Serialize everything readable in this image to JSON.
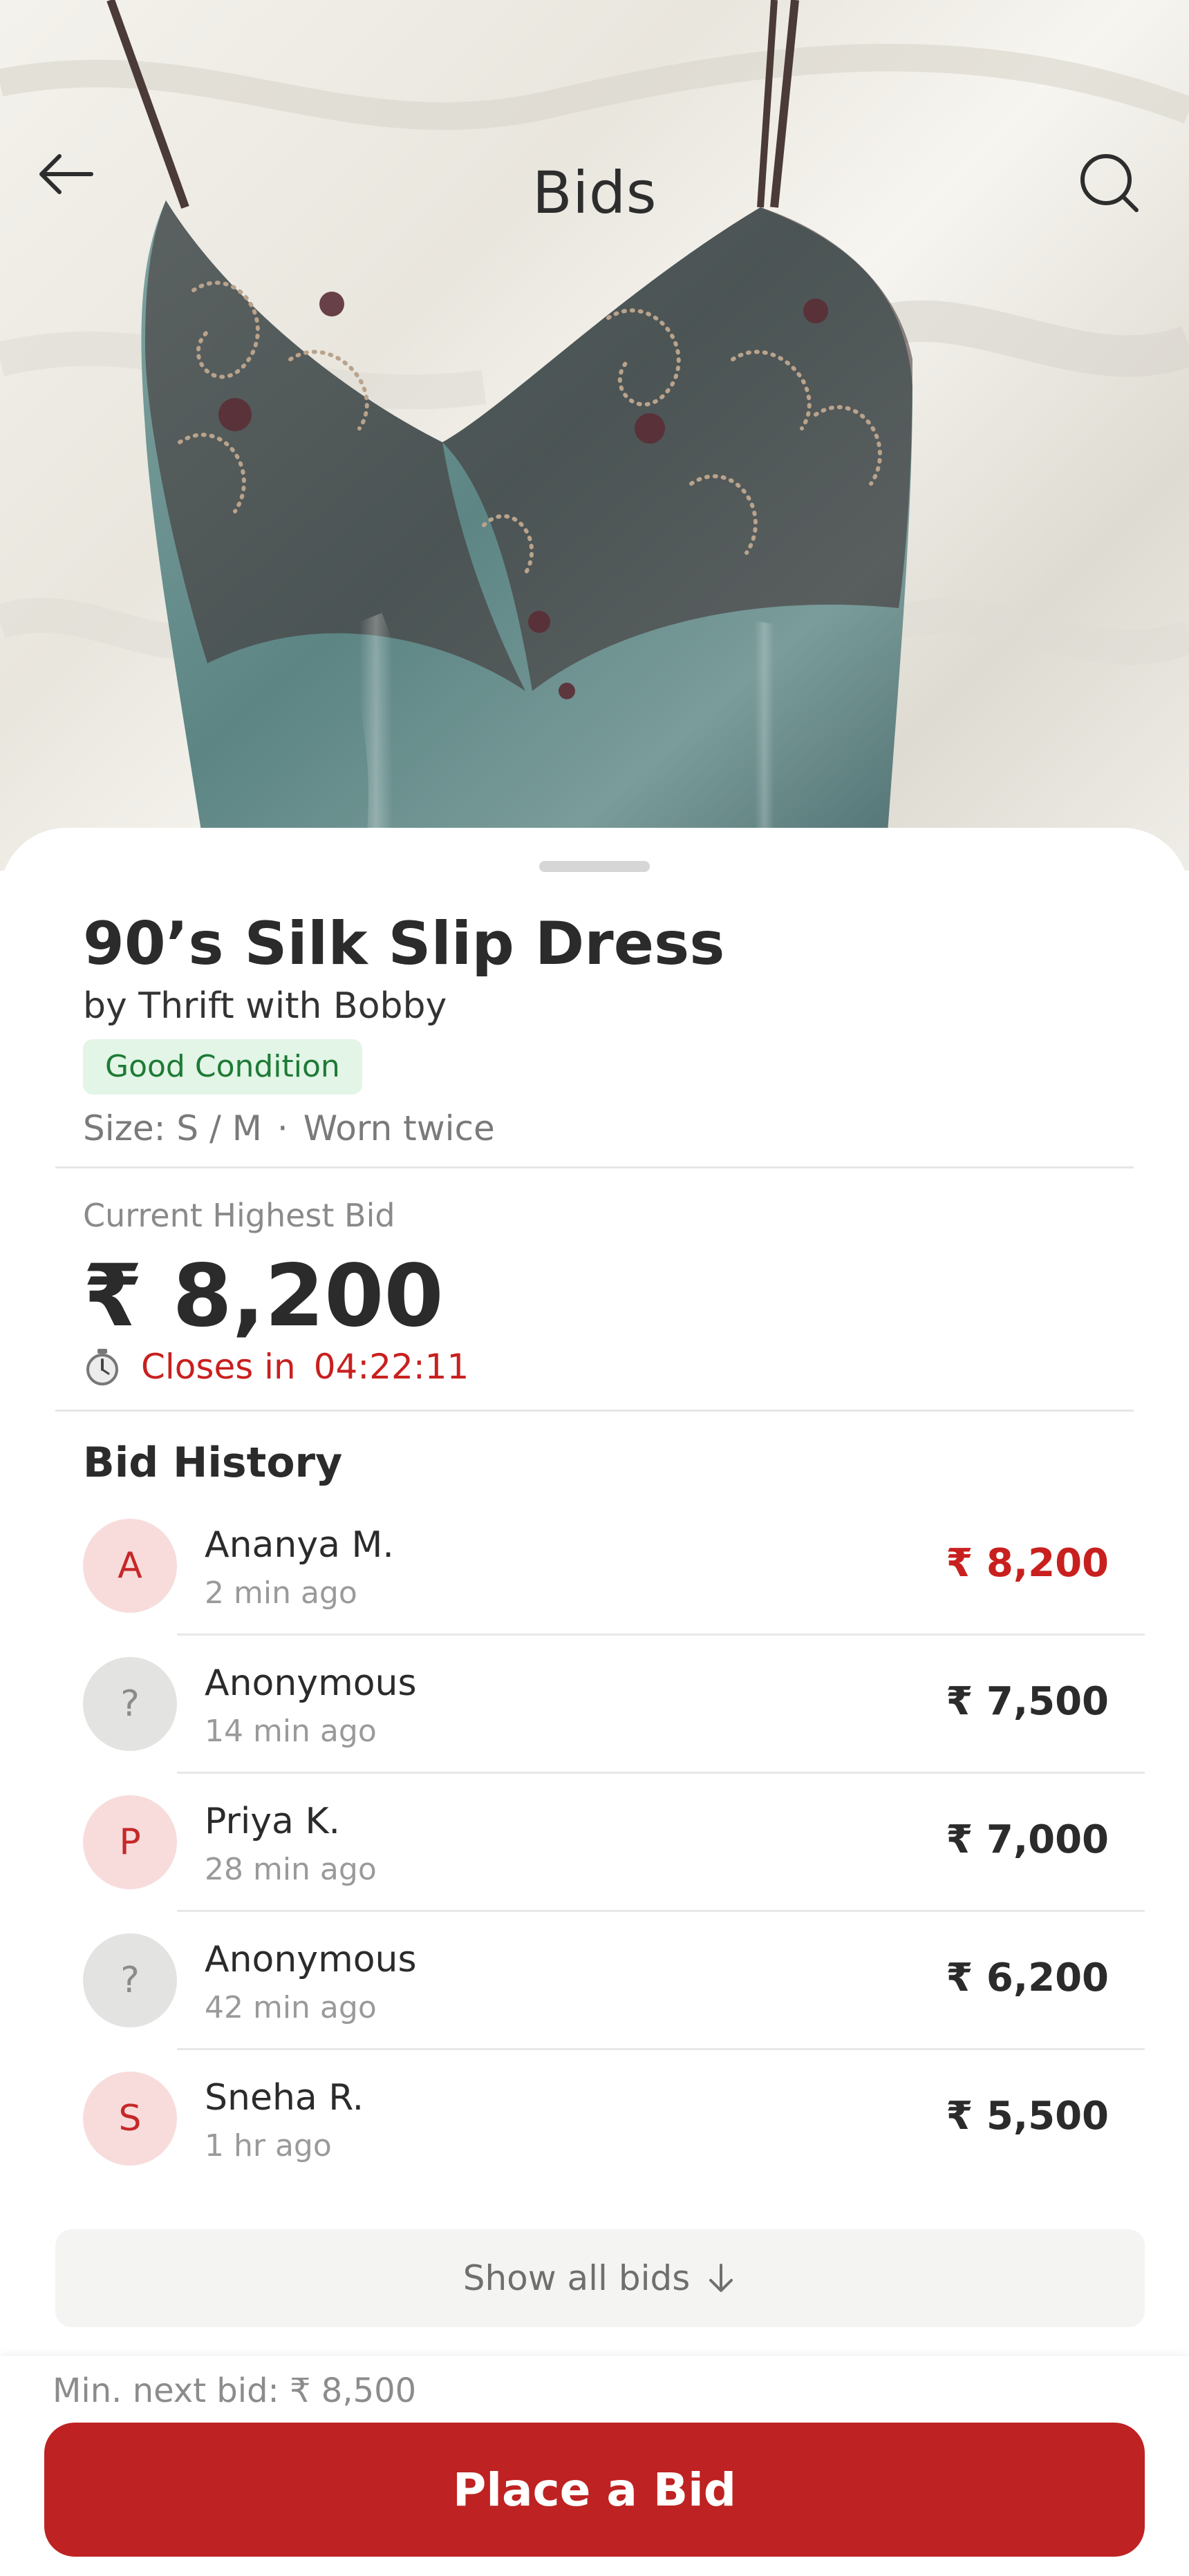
{
  "header": {
    "title": "Bids",
    "back_icon": "arrow-left-icon",
    "search_icon": "search-icon"
  },
  "item": {
    "title": "90’s Silk Slip Dress",
    "seller": "by Thrift with Bobby",
    "condition": "Good Condition",
    "size": "Size: S / M",
    "separator": "·",
    "wear": "Worn twice"
  },
  "auction": {
    "current_label": "Current Highest Bid",
    "current_amount": "₹ 8,200",
    "closes_label": "Closes in",
    "closes_time": "04:22:11",
    "timer_icon": "stopwatch-icon"
  },
  "history": {
    "title": "Bid History",
    "bids": [
      {
        "initial": "A",
        "name": "Ananya M.",
        "time": "2 min ago",
        "amount": "₹ 8,200"
      },
      {
        "initial": "?",
        "name": "Anonymous",
        "time": "14 min ago",
        "amount": "₹ 7,500"
      },
      {
        "initial": "P",
        "name": "Priya K.",
        "time": "28 min ago",
        "amount": "₹ 7,000"
      },
      {
        "initial": "?",
        "name": "Anonymous",
        "time": "42 min ago",
        "amount": "₹ 6,200"
      },
      {
        "initial": "S",
        "name": "Sneha R.",
        "time": "1 hr ago",
        "amount": "₹ 5,500"
      }
    ],
    "show_all_label": "Show all bids",
    "show_all_icon": "arrow-down-icon"
  },
  "footer": {
    "min_next_bid": "Min. next bid: ₹ 8,500",
    "place_bid_label": "Place a Bid"
  },
  "colors": {
    "accent": "#be2222",
    "badge_bg": "#e2f5e6",
    "badge_text": "#1e7a36"
  }
}
